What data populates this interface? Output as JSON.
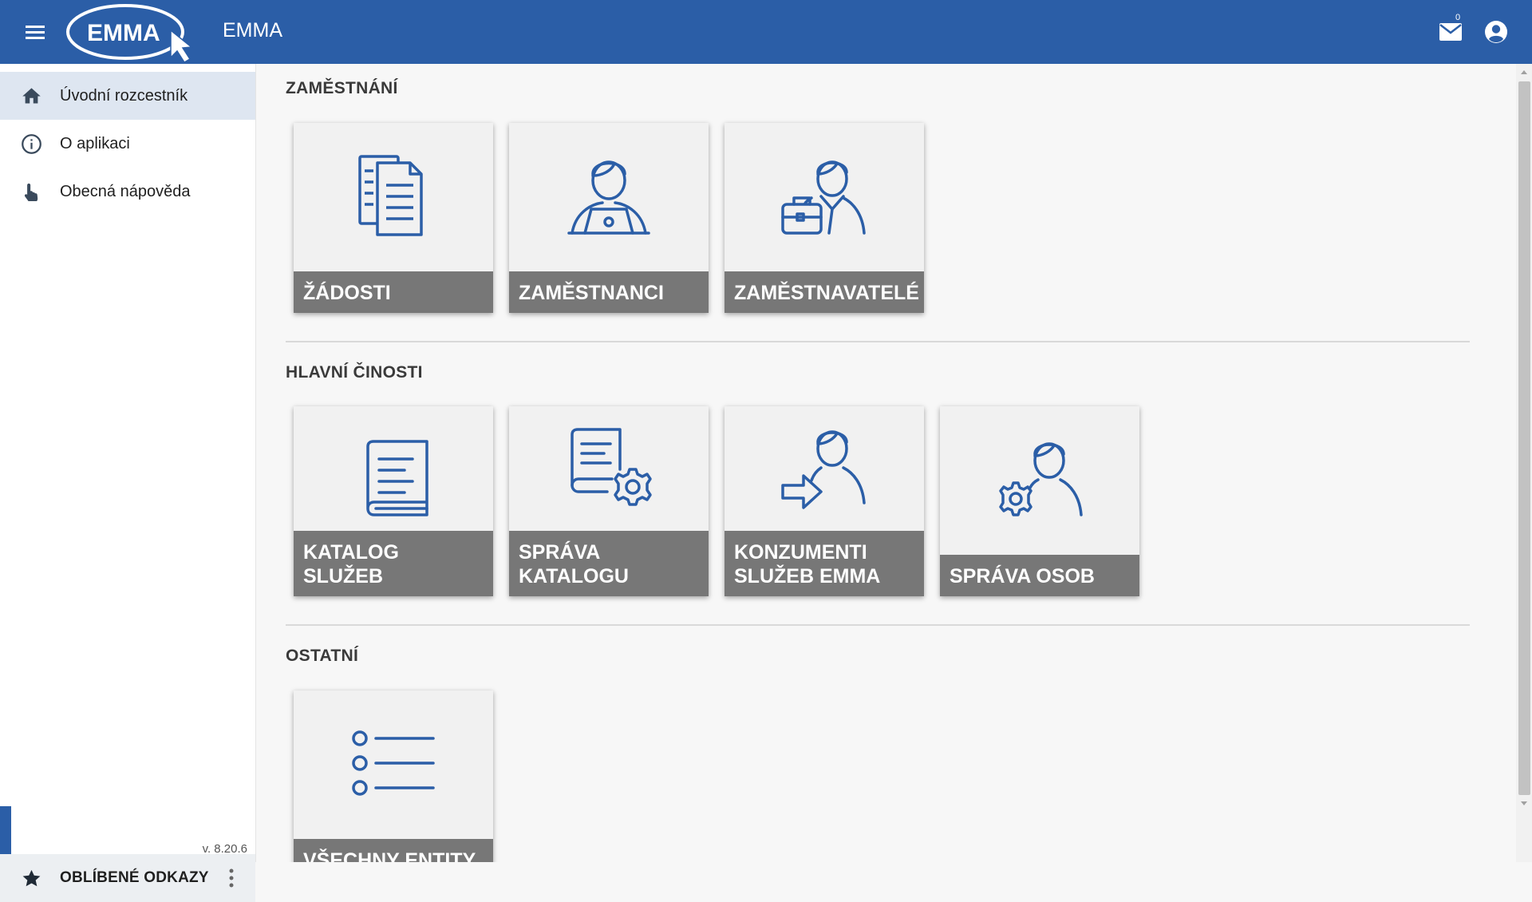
{
  "header": {
    "logo_text": "EMMA",
    "app_title": "EMMA",
    "mail_count": "0"
  },
  "sidebar": {
    "items": [
      {
        "label": "Úvodní rozcestník",
        "icon": "home-icon",
        "active": true
      },
      {
        "label": "O aplikaci",
        "icon": "info-icon",
        "active": false
      },
      {
        "label": "Obecná nápověda",
        "icon": "touch-hand-icon",
        "active": false
      }
    ],
    "favorites_label": "OBLÍBENÉ ODKAZY",
    "version": "v. 8.20.6"
  },
  "sections": [
    {
      "title": "ZAMĚSTNÁNÍ",
      "tiles": [
        {
          "label": "ŽÁDOSTI",
          "icon": "documents-icon"
        },
        {
          "label": "ZAMĚSTNANCI",
          "icon": "employee-laptop-icon"
        },
        {
          "label": "ZAMĚSTNAVATELÉ",
          "icon": "employer-briefcase-icon"
        }
      ]
    },
    {
      "title": "HLAVNÍ ČINOSTI",
      "tiles": [
        {
          "label": "KATALOG SLUŽEB",
          "icon": "catalog-book-icon"
        },
        {
          "label": "SPRÁVA KATALOGU",
          "icon": "catalog-settings-icon"
        },
        {
          "label": "KONZUMENTI SLUŽEB EMMA",
          "icon": "person-arrow-icon"
        },
        {
          "label": "SPRÁVA OSOB",
          "icon": "person-settings-icon"
        }
      ]
    },
    {
      "title": "OSTATNÍ",
      "tiles": [
        {
          "label": "VŠECHNY ENTITY",
          "icon": "list-icon"
        }
      ]
    }
  ],
  "colors": {
    "primary": "#2b5ea7",
    "tile_label_bg": "#777777",
    "active_nav_bg": "#dee6f1"
  }
}
